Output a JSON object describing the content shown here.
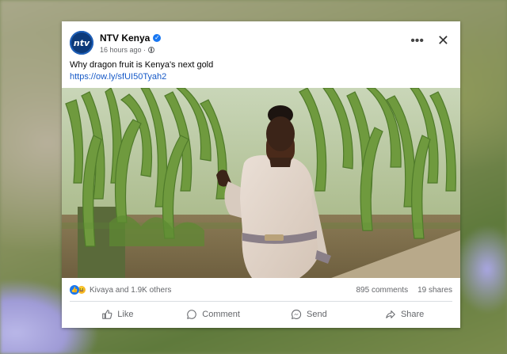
{
  "post": {
    "page_name": "NTV Kenya",
    "avatar_text": "ntv",
    "timestamp": "16 hours ago ·",
    "text": "Why dragon fruit is Kenya's next gold",
    "link": "https://ow.ly/sfUI50Tyah2",
    "reactors": "Kivaya and 1.9K others",
    "comments": "895 comments",
    "shares": "19 shares"
  },
  "actions": {
    "like": "Like",
    "comment": "Comment",
    "send": "Send",
    "share": "Share"
  },
  "icons": {
    "verified": "verified-badge-icon",
    "audience": "globe-icon",
    "more": "more-options-icon",
    "close": "close-icon"
  },
  "colors": {
    "brand_blue": "#1877f2",
    "link_blue": "#1659c7",
    "secondary_text": "#65676b"
  }
}
